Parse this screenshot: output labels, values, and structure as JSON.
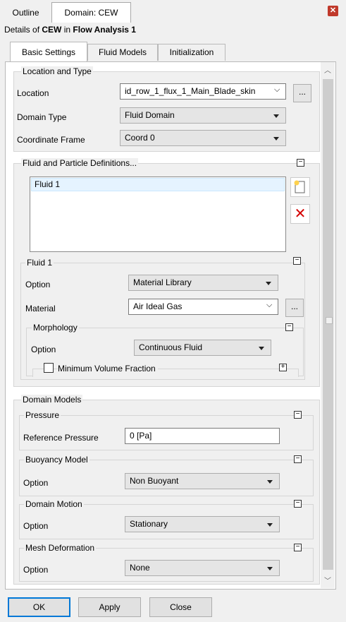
{
  "top_tabs": [
    "Outline",
    "Domain: CEW"
  ],
  "title": {
    "prefix": "Details of ",
    "object": "CEW",
    "middle": " in ",
    "analysis": "Flow Analysis 1"
  },
  "inner_tabs": [
    "Basic Settings",
    "Fluid Models",
    "Initialization"
  ],
  "location_and_type": {
    "title": "Location and Type",
    "location_label": "Location",
    "location_value": "id_row_1_flux_1_Main_Blade_skin",
    "domain_type_label": "Domain Type",
    "domain_type_value": "Fluid Domain",
    "coord_label": "Coordinate Frame",
    "coord_value": "Coord 0"
  },
  "fluid_definitions": {
    "title": "Fluid and Particle Definitions...",
    "items": [
      "Fluid 1"
    ]
  },
  "fluid1": {
    "title": "Fluid 1",
    "option_label": "Option",
    "option_value": "Material Library",
    "material_label": "Material",
    "material_value": "Air Ideal Gas",
    "morphology": {
      "title": "Morphology",
      "option_label": "Option",
      "option_value": "Continuous Fluid",
      "min_vol_label": "Minimum Volume Fraction"
    }
  },
  "domain_models": {
    "title": "Domain Models",
    "pressure": {
      "title": "Pressure",
      "ref_label": "Reference Pressure",
      "ref_value": "0 [Pa]"
    },
    "buoyancy": {
      "title": "Buoyancy Model",
      "option_label": "Option",
      "option_value": "Non Buoyant"
    },
    "motion": {
      "title": "Domain Motion",
      "option_label": "Option",
      "option_value": "Stationary"
    },
    "mesh": {
      "title": "Mesh Deformation",
      "option_label": "Option",
      "option_value": "None"
    }
  },
  "buttons": {
    "ok": "OK",
    "apply": "Apply",
    "close": "Close"
  },
  "icons": {
    "close": "close-icon",
    "new": "new-item-icon",
    "delete": "delete-icon",
    "more": "..."
  }
}
